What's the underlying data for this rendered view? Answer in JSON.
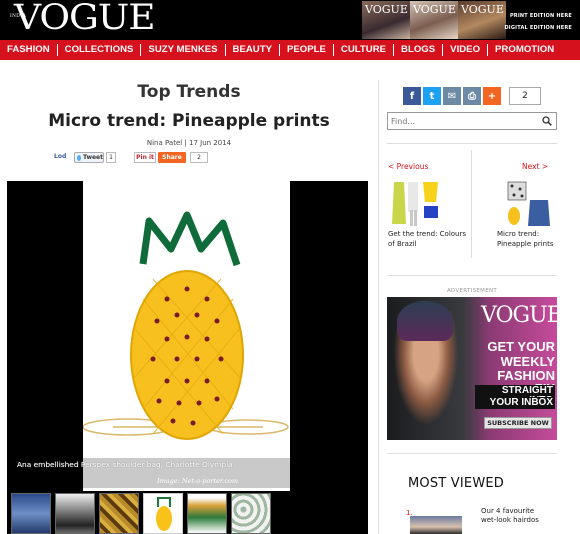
{
  "header": {
    "logo": "VOGUE",
    "edition": "INDIA",
    "covers": [
      "VOGUE",
      "VOGUE",
      "VOGUE"
    ],
    "print_edition": "PRINT EDITION HERE",
    "digital_edition": "DIGITAL EDITION HERE"
  },
  "nav": [
    "FASHION",
    "COLLECTIONS",
    "SUZY MENKES",
    "BEAUTY",
    "PEOPLE",
    "CULTURE",
    "BLOGS",
    "VIDEO",
    "PROMOTION"
  ],
  "article": {
    "section": "Top Trends",
    "title": "Micro trend: Pineapple prints",
    "byline": "Nina Patel | 17 Jun 2014",
    "share": {
      "lod": "Lod",
      "tweet": "Tweet",
      "tweet_count": "1",
      "pin": "Pin it",
      "share": "Share",
      "share_count": "2"
    },
    "image": {
      "caption": "Ana embellished Perspex shoulder bag, Charlotte Olympia",
      "credit": "Image: Net-a-porter.com"
    }
  },
  "sidebar": {
    "share_count": "2",
    "search_placeholder": "Find...",
    "prev_label": "< Previous",
    "next_label": "Next >",
    "prev_caption": "Get the trend: Colours of Brazil",
    "next_caption": "Micro trend: Pineapple prints",
    "ad": {
      "label": "ADVERTISEMENT",
      "logo": "VOGUE",
      "line1": "GET YOUR",
      "line2": "WEEKLY",
      "line3": "FASHION FIX",
      "line4": "STRAIGHT INTO",
      "line5": "YOUR INBOX",
      "button": "SUBSCRIBE NOW"
    },
    "most_viewed": {
      "title": "MOST VIEWED",
      "item_number": "1.",
      "item_text": "Our 4 favourite wet-look hairdos"
    }
  },
  "colors": {
    "brand_red": "#d6111e",
    "facebook": "#3b5998",
    "twitter": "#1da1f2"
  }
}
